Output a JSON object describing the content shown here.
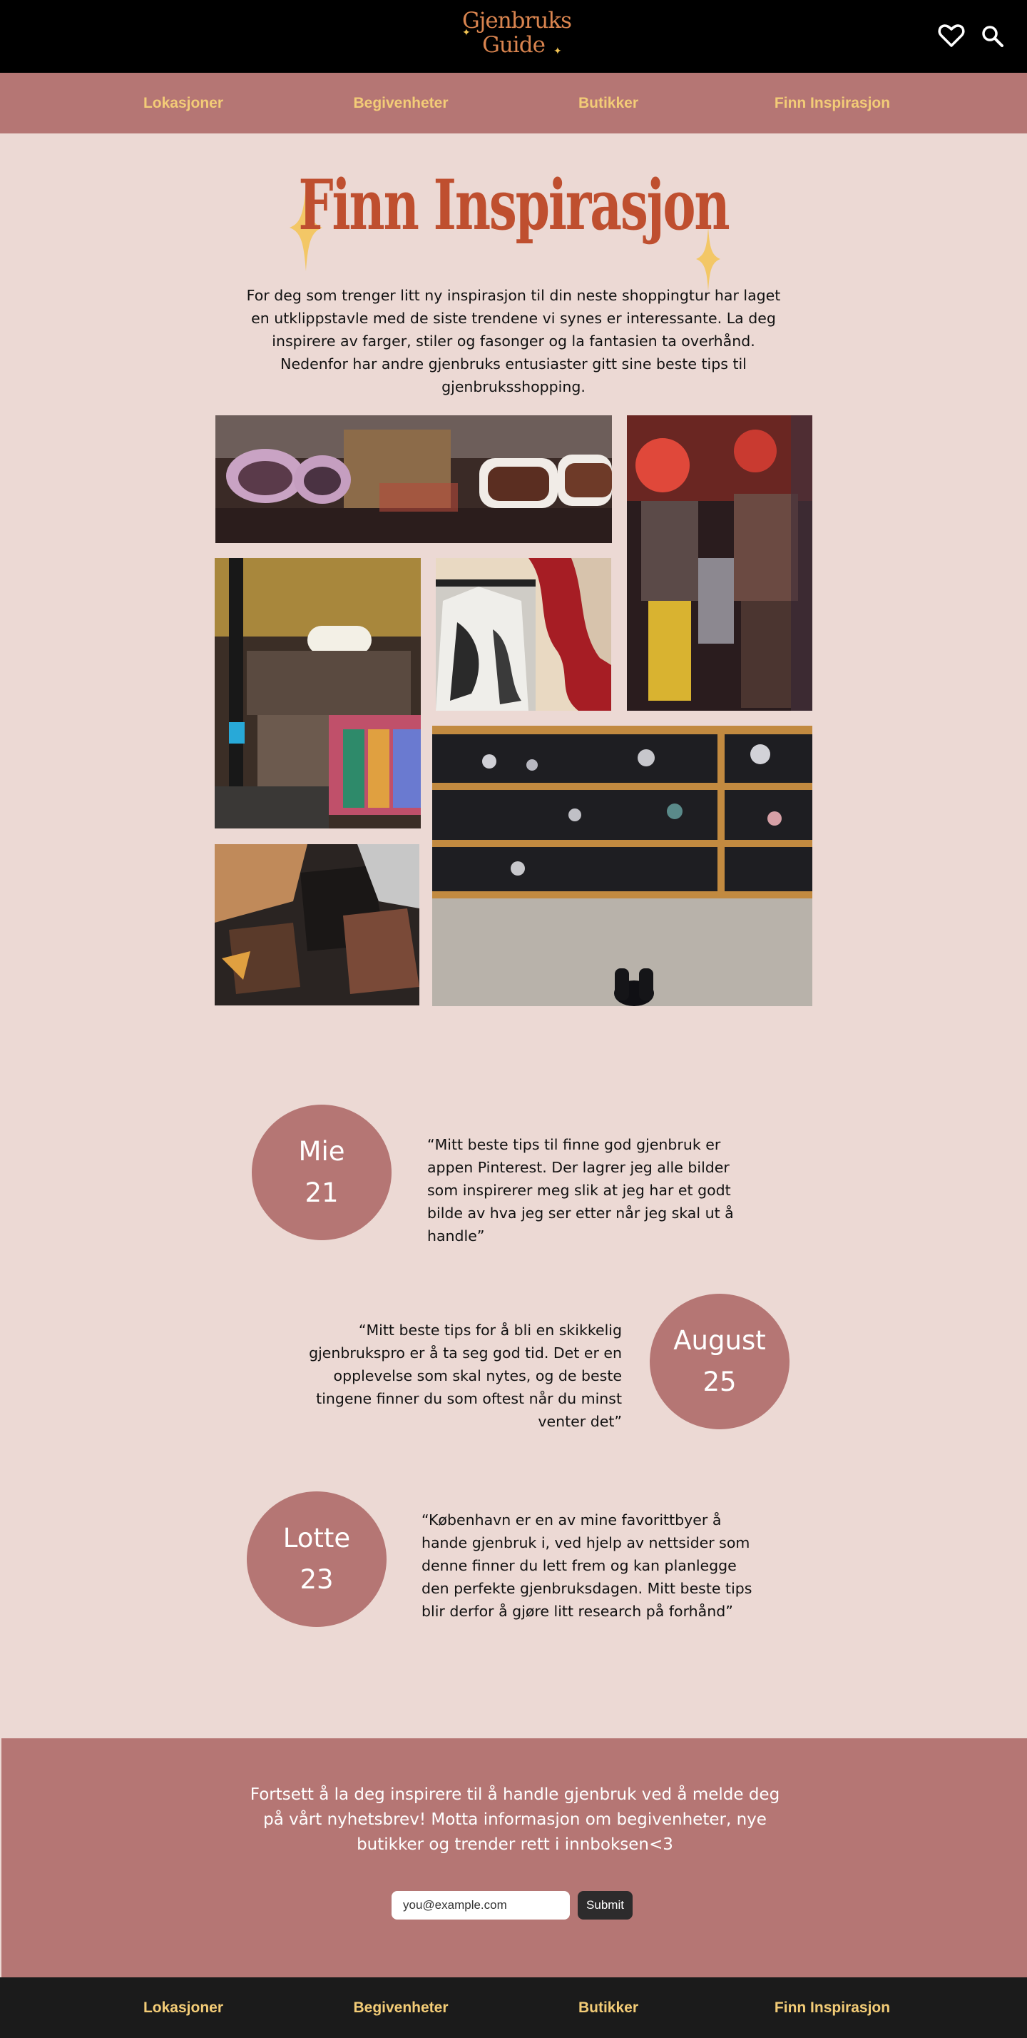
{
  "header": {
    "logo_line1": "Gjenbruks",
    "logo_line2": "Guide",
    "icons": [
      "heart-icon",
      "search-icon"
    ]
  },
  "nav": {
    "items": [
      {
        "label": "Lokasjoner"
      },
      {
        "label": "Begivenheter"
      },
      {
        "label": "Butikker"
      },
      {
        "label": "Finn Inspirasjon"
      }
    ]
  },
  "hero": {
    "title": "Finn Inspirasjon",
    "intro": "For deg som trenger litt ny inspirasjon til din neste shoppingtur har laget en utklippstavle med de siste trendene vi synes er interessante. La deg inspirere av farger, stiler og fasonger og la fantasien ta overhånd. Nedenfor har andre gjenbruks entusiaster gitt sine beste tips til gjenbruksshopping."
  },
  "quotes": [
    {
      "name": "Mie",
      "age": "21",
      "text": "“Mitt beste tips til finne god gjenbruk er appen Pinterest. Der lagrer jeg alle bilder som inspirerer meg slik at jeg har et godt bilde av hva jeg ser etter når jeg skal ut å handle”"
    },
    {
      "name": "August",
      "age": "25",
      "text": "“Mitt beste tips for å bli en skikkelig gjenbrukspro er å ta seg god tid. Det er en opplevelse som skal nytes, og de beste tingene finner du som oftest når du minst venter det”"
    },
    {
      "name": "Lotte",
      "age": "23",
      "text": "“København er en av mine favorittbyer å hande gjenbruk i, ved hjelp av nettsider som denne finner du lett frem og kan planlegge den perfekte gjenbruksdagen. Mitt beste tips blir derfor å gjøre litt research på forhånd”"
    }
  ],
  "newsletter": {
    "text": "Fortsett å la deg inspirere til å handle gjenbruk ved å melde deg på vårt nyhetsbrev! Motta informasjon om begivenheter, nye butikker og trender rett i innboksen<3",
    "email_placeholder": "you@example.com",
    "submit_label": "Submit"
  },
  "colors": {
    "page_bg": "#ecd9d4",
    "nav_bg": "#b57674",
    "nav_text": "#f3cc77",
    "title": "#bf4f2f",
    "accent_star": "#f2c453",
    "footer_bg": "#1b1b1b"
  }
}
